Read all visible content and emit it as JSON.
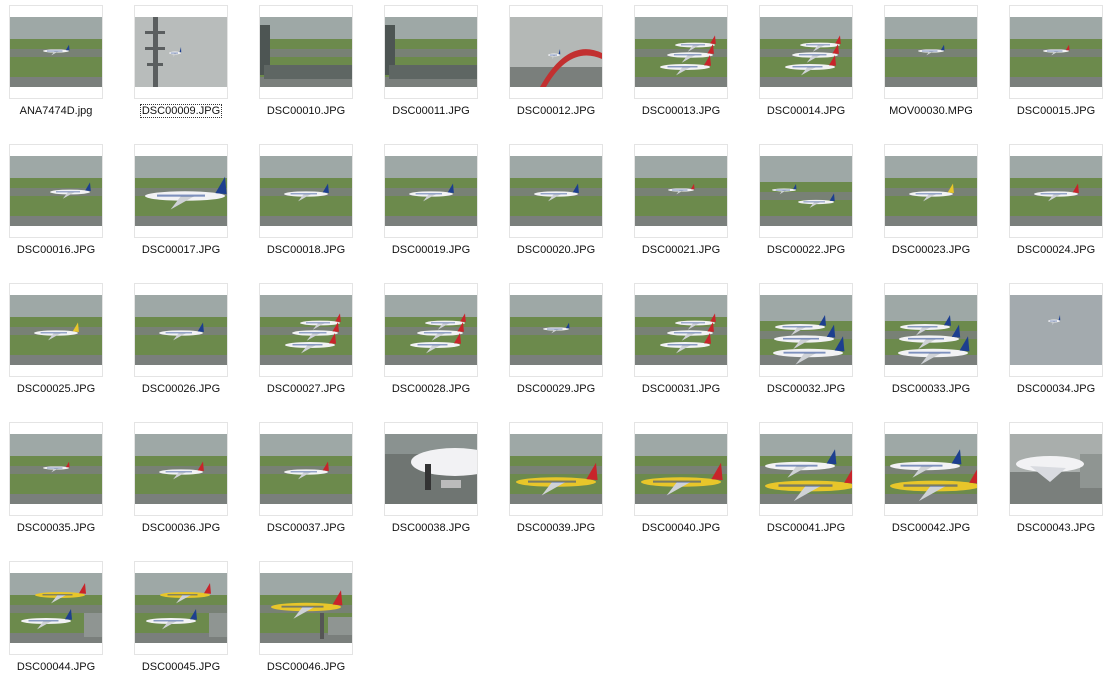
{
  "window": {
    "view": "thumbnails"
  },
  "focused_index": 1,
  "palette": {
    "sky": "#9ea8a6",
    "grass": "#6c8a4c",
    "tarmac": "#7a7f7c",
    "fuselage": "#f2f2f4",
    "ana_blue": "#1d3f8f",
    "jal_red": "#c8242a",
    "pokemon_yellow": "#e8c62a"
  },
  "files": [
    {
      "name": "ANA7474D.jpg",
      "scene": "plane-far",
      "tail": "ana_blue"
    },
    {
      "name": "DSC00009.JPG",
      "scene": "tower",
      "tail": "ana_blue"
    },
    {
      "name": "DSC00010.JPG",
      "scene": "building-plane",
      "tail": "ana_blue"
    },
    {
      "name": "DSC00011.JPG",
      "scene": "building-plane",
      "tail": "ana_blue"
    },
    {
      "name": "DSC00012.JPG",
      "scene": "arch",
      "tail": "ana_blue"
    },
    {
      "name": "DSC00013.JPG",
      "scene": "multi-jal",
      "tail": "jal_red"
    },
    {
      "name": "DSC00014.JPG",
      "scene": "multi-jal",
      "tail": "jal_red"
    },
    {
      "name": "MOV00030.MPG",
      "scene": "plane-far",
      "tail": "ana_blue"
    },
    {
      "name": "DSC00015.JPG",
      "scene": "plane-far",
      "tail": "jal_red"
    },
    {
      "name": "DSC00016.JPG",
      "scene": "plane-near",
      "tail": "ana_blue"
    },
    {
      "name": "DSC00017.JPG",
      "scene": "plane-close",
      "tail": "ana_blue"
    },
    {
      "name": "DSC00018.JPG",
      "scene": "plane-mid",
      "tail": "ana_blue"
    },
    {
      "name": "DSC00019.JPG",
      "scene": "plane-mid",
      "tail": "ana_blue"
    },
    {
      "name": "DSC00020.JPG",
      "scene": "plane-mid",
      "tail": "ana_blue"
    },
    {
      "name": "DSC00021.JPG",
      "scene": "plane-far",
      "tail": "jal_red"
    },
    {
      "name": "DSC00022.JPG",
      "scene": "apron",
      "tail": "ana_blue"
    },
    {
      "name": "DSC00023.JPG",
      "scene": "plane-mid",
      "tail": "pokemon_yellow"
    },
    {
      "name": "DSC00024.JPG",
      "scene": "plane-mid",
      "tail": "jal_red"
    },
    {
      "name": "DSC00025.JPG",
      "scene": "plane-mid",
      "tail": "pokemon_yellow"
    },
    {
      "name": "DSC00026.JPG",
      "scene": "plane-mid",
      "tail": "ana_blue"
    },
    {
      "name": "DSC00027.JPG",
      "scene": "multi-jal",
      "tail": "jal_red"
    },
    {
      "name": "DSC00028.JPG",
      "scene": "multi-jal",
      "tail": "jal_red"
    },
    {
      "name": "DSC00029.JPG",
      "scene": "plane-far",
      "tail": "ana_blue"
    },
    {
      "name": "DSC00031.JPG",
      "scene": "multi-jal",
      "tail": "jal_red"
    },
    {
      "name": "DSC00032.JPG",
      "scene": "apron-multi",
      "tail": "ana_blue"
    },
    {
      "name": "DSC00033.JPG",
      "scene": "apron-multi",
      "tail": "ana_blue"
    },
    {
      "name": "DSC00034.JPG",
      "scene": "sky",
      "tail": "ana_blue"
    },
    {
      "name": "DSC00035.JPG",
      "scene": "plane-far",
      "tail": "jal_red"
    },
    {
      "name": "DSC00036.JPG",
      "scene": "plane-mid",
      "tail": "jal_red"
    },
    {
      "name": "DSC00037.JPG",
      "scene": "plane-mid",
      "tail": "jal_red"
    },
    {
      "name": "DSC00038.JPG",
      "scene": "close-nose",
      "tail": "ana_blue"
    },
    {
      "name": "DSC00039.JPG",
      "scene": "pokemon",
      "tail": "pokemon_yellow"
    },
    {
      "name": "DSC00040.JPG",
      "scene": "pokemon",
      "tail": "pokemon_yellow"
    },
    {
      "name": "DSC00041.JPG",
      "scene": "pokemon-close",
      "tail": "pokemon_yellow"
    },
    {
      "name": "DSC00042.JPG",
      "scene": "pokemon-close",
      "tail": "pokemon_yellow"
    },
    {
      "name": "DSC00043.JPG",
      "scene": "gate",
      "tail": "ana_blue"
    },
    {
      "name": "DSC00044.JPG",
      "scene": "gate-pokemon",
      "tail": "pokemon_yellow"
    },
    {
      "name": "DSC00045.JPG",
      "scene": "gate-pokemon",
      "tail": "pokemon_yellow"
    },
    {
      "name": "DSC00046.JPG",
      "scene": "pokemon-gate",
      "tail": "pokemon_yellow"
    }
  ]
}
